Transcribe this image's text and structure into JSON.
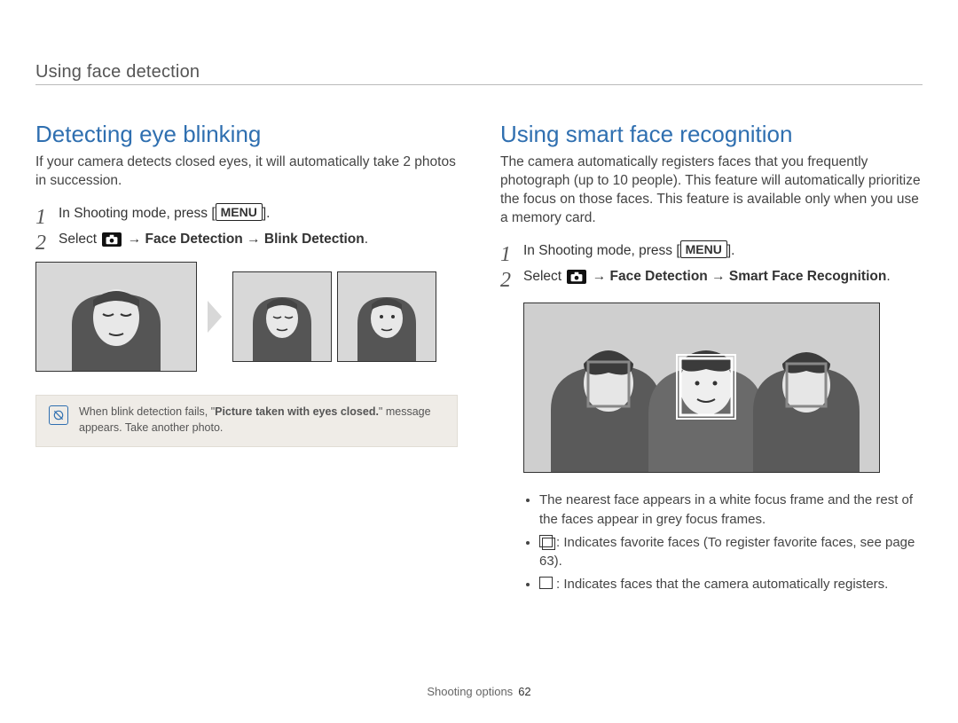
{
  "header": {
    "breadcrumb": "Using face detection"
  },
  "left": {
    "title": "Detecting eye blinking",
    "intro": "If your camera detects closed eyes, it will automatically take 2 photos in succession.",
    "step1_prefix": "In Shooting mode, press [",
    "step1_suffix": "].",
    "menu_label": "MENU",
    "step2_prefix": "Select ",
    "step2_arrow": " → ",
    "step2_a": "Face Detection",
    "step2_b": "Blink Detection",
    "step2_suffix": ".",
    "note_prefix": "When blink detection fails, \"",
    "note_bold": "Picture taken with eyes closed.",
    "note_suffix": "\" message appears. Take another photo."
  },
  "right": {
    "title": "Using smart face recognition",
    "intro": "The camera automatically registers faces that you frequently photograph (up to 10 people). This feature will automatically prioritize the focus on those faces. This feature is available only when you use a memory card.",
    "step1_prefix": "In Shooting mode, press [",
    "step1_suffix": "].",
    "menu_label": "MENU",
    "step2_prefix": "Select ",
    "step2_arrow": " → ",
    "step2_a": "Face Detection",
    "step2_b": "Smart Face Recognition",
    "step2_suffix": ".",
    "bullets": {
      "b1": "The nearest face appears in a white focus frame and the rest of the faces appear in grey focus frames.",
      "b2": ": Indicates favorite faces (To register favorite faces, see page 63).",
      "b3": ": Indicates faces that the camera automatically registers."
    }
  },
  "footer": {
    "section": "Shooting options",
    "page": "62"
  }
}
